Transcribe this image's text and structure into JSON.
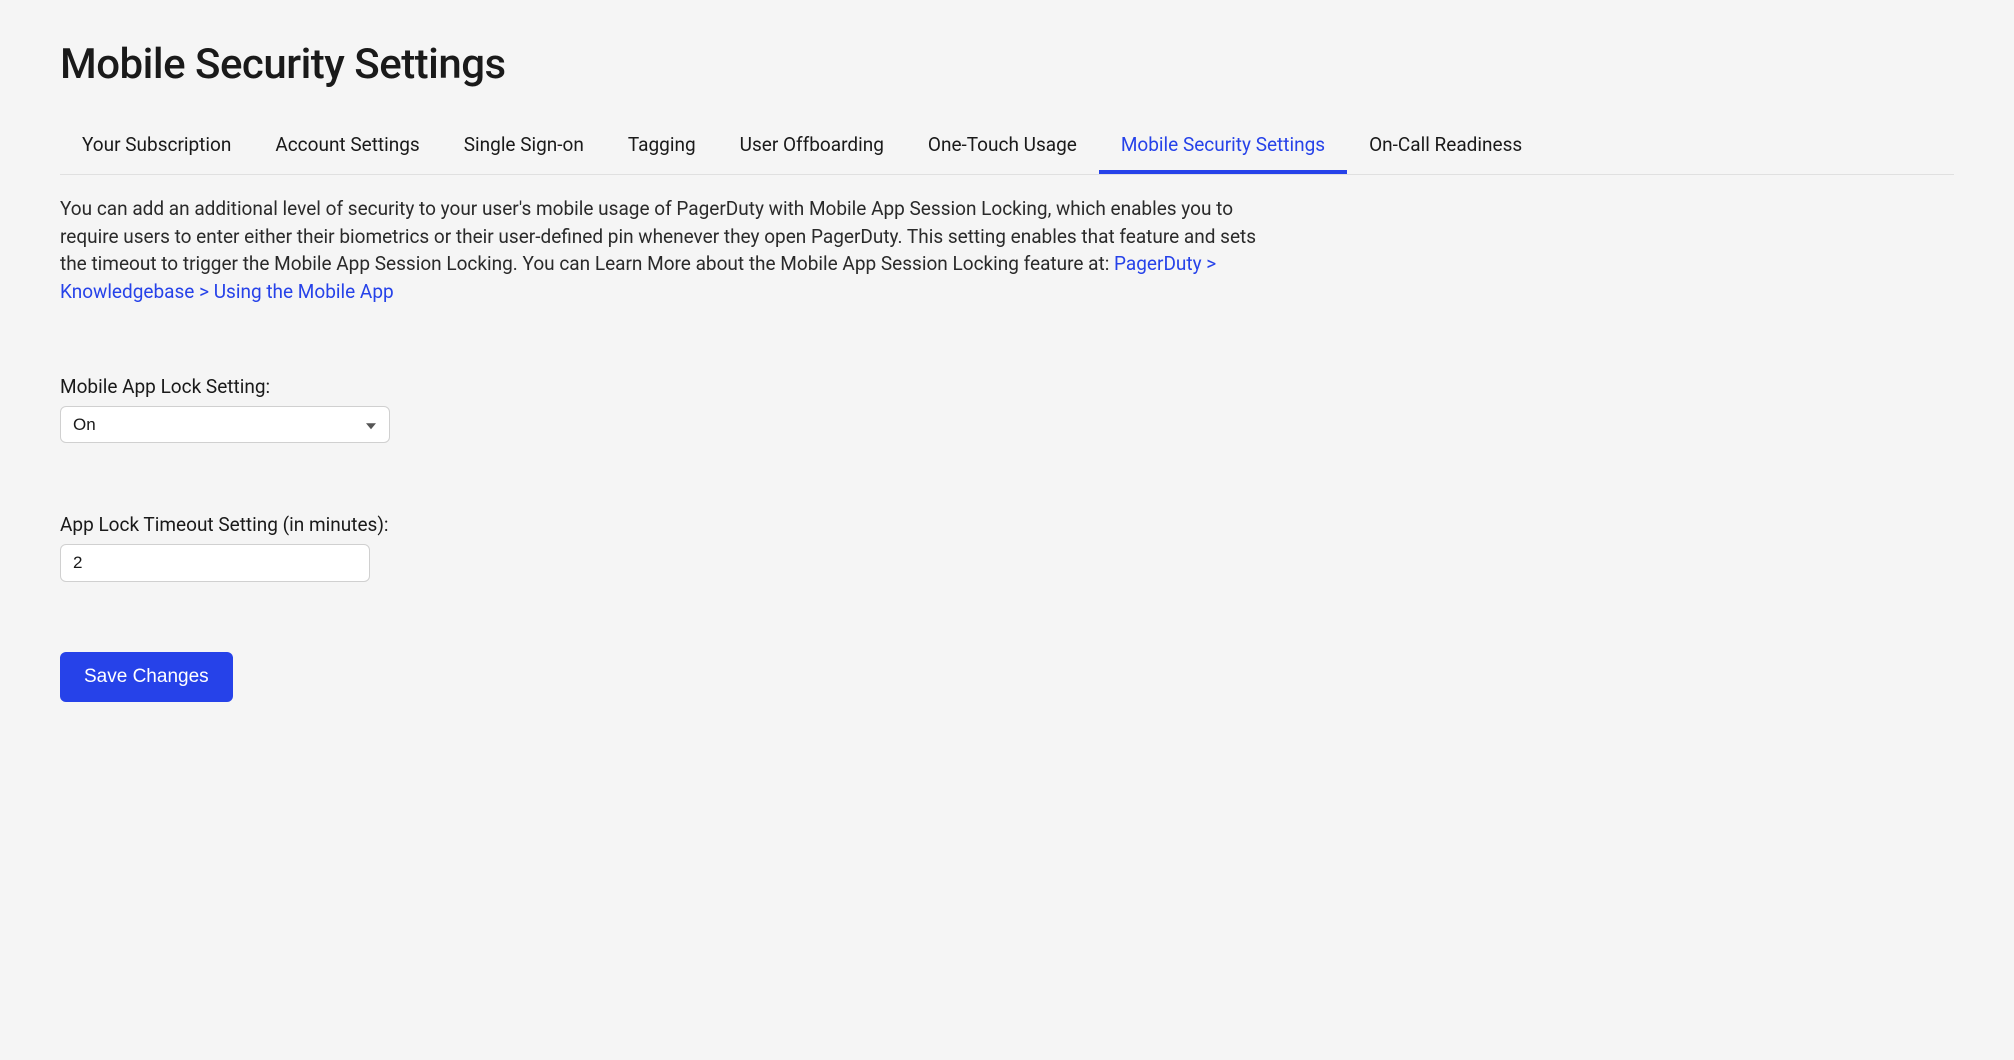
{
  "page": {
    "title": "Mobile Security Settings"
  },
  "tabs": [
    {
      "label": "Your Subscription",
      "active": false
    },
    {
      "label": "Account Settings",
      "active": false
    },
    {
      "label": "Single Sign-on",
      "active": false
    },
    {
      "label": "Tagging",
      "active": false
    },
    {
      "label": "User Offboarding",
      "active": false
    },
    {
      "label": "One-Touch Usage",
      "active": false
    },
    {
      "label": "Mobile Security Settings",
      "active": true
    },
    {
      "label": "On-Call Readiness",
      "active": false
    }
  ],
  "description": {
    "text": "You can add an additional level of security to your user's mobile usage of PagerDuty with Mobile App Session Locking, which enables you to require users to enter either their biometrics or their user-defined pin whenever they open PagerDuty. This setting enables that feature and sets the timeout to trigger the Mobile App Session Locking. You can Learn More about the Mobile App Session Locking feature at: ",
    "link_text": "PagerDuty > Knowledgebase > Using the Mobile App"
  },
  "form": {
    "lock_setting": {
      "label": "Mobile App Lock Setting:",
      "value": "On"
    },
    "timeout_setting": {
      "label": "App Lock Timeout Setting (in minutes):",
      "value": "2"
    },
    "save_label": "Save Changes"
  }
}
